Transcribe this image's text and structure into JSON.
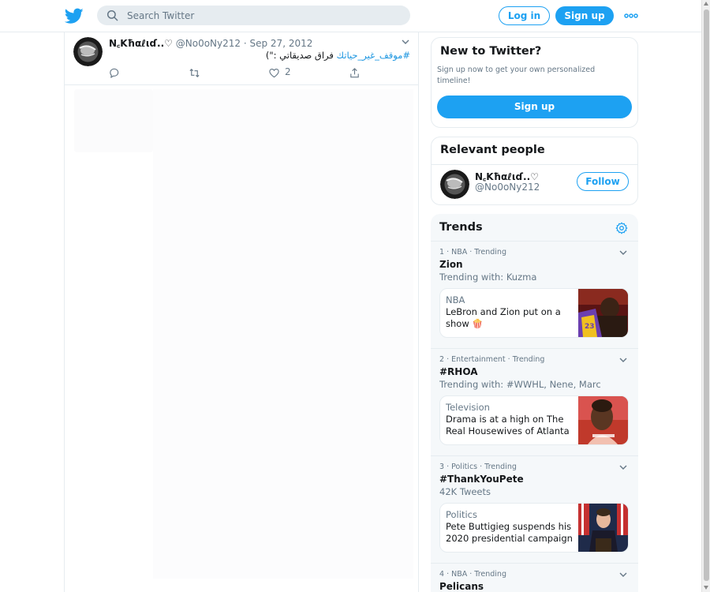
{
  "colors": {
    "brand": "#1da1f2",
    "link": "#1b95e0",
    "text": "#14171a",
    "muted": "#657786",
    "border": "#e6ecf0",
    "panel": "#f5f8fa"
  },
  "header": {
    "logo_icon": "twitter-bird-icon",
    "search_placeholder": "Search Twitter",
    "login_label": "Log in",
    "signup_label": "Sign up",
    "more_icon": "more-dots-icon"
  },
  "tweet": {
    "author_name": "N꜀Kħαℓιɗ..♡",
    "handle_date": "@No0oNy212 · Sep 27, 2012",
    "hashtag": "#موقف_غير_حياتك",
    "text": "فراق صديقاتي :\")",
    "like_count": "2",
    "actions": [
      "reply-icon",
      "retweet-icon",
      "like-icon",
      "share-icon"
    ]
  },
  "new_to_twitter": {
    "title": "New to Twitter?",
    "description": "Sign up now to get your own personalized timeline!",
    "button_label": "Sign up"
  },
  "relevant_people": {
    "title": "Relevant people",
    "name": "N꜀Kħαℓιɗ..♡",
    "handle": "@No0oNy212",
    "follow_label": "Follow"
  },
  "trends": {
    "title": "Trends",
    "items": [
      {
        "meta": "1 · NBA · Trending",
        "name": "Zion",
        "subtitle": "Trending with: Kuzma",
        "card_category": "NBA",
        "card_headline": "LeBron and Zion put on a show 🍿"
      },
      {
        "meta": "2 · Entertainment · Trending",
        "name": "#RHOA",
        "subtitle": "Trending with: #WWHL, Nene, Marc",
        "card_category": "Television",
        "card_headline": "Drama is at a high on The Real Housewives of Atlanta"
      },
      {
        "meta": "3 · Politics · Trending",
        "name": "#ThankYouPete",
        "subtitle": "42K Tweets",
        "card_category": "Politics",
        "card_headline": "Pete Buttigieg suspends his 2020 presidential campaign"
      },
      {
        "meta": "4 · NBA · Trending",
        "name": "Pelicans"
      }
    ]
  }
}
